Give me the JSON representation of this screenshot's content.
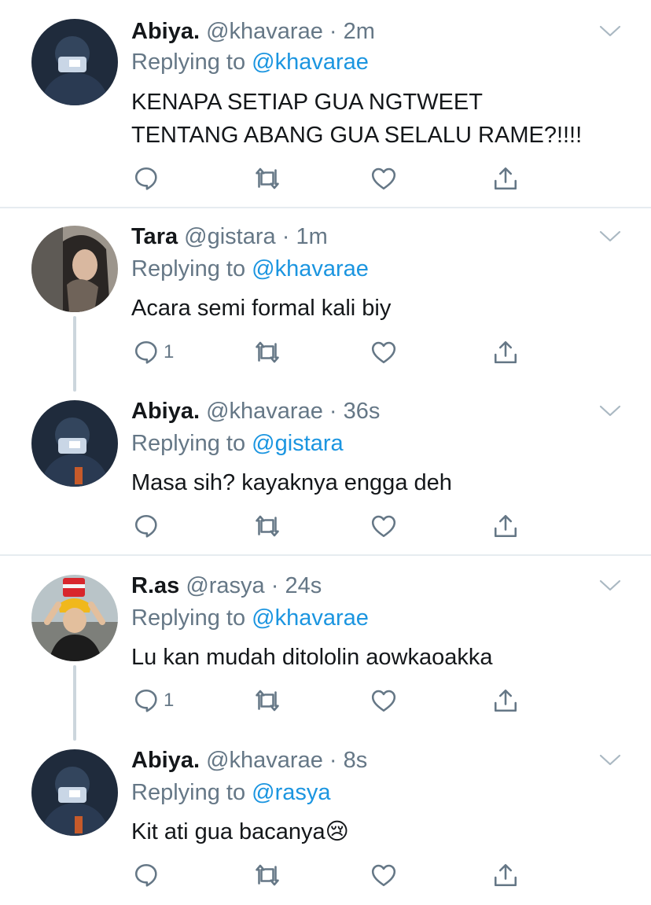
{
  "tweets": [
    {
      "name": "Abiya.",
      "handle": "@khavarae",
      "time": "2m",
      "replying_prefix": "Replying to ",
      "replying_to": "@khavarae",
      "text_lines": [
        "KENAPA SETIAP GUA NGTWEET",
        "TENTANG ABANG GUA SELALU RAME?!!!!"
      ],
      "reply_count": ""
    },
    {
      "name": "Tara",
      "handle": "@gistara",
      "time": "1m",
      "replying_prefix": "Replying to ",
      "replying_to": "@khavarae",
      "text_lines": [
        "Acara semi formal kali biy"
      ],
      "reply_count": "1"
    },
    {
      "name": "Abiya.",
      "handle": "@khavarae",
      "time": "36s",
      "replying_prefix": "Replying to ",
      "replying_to": "@gistara",
      "text_lines": [
        "Masa sih? kayaknya engga deh"
      ],
      "reply_count": ""
    },
    {
      "name": "R.as",
      "handle": "@rasya",
      "time": "24s",
      "replying_prefix": "Replying to ",
      "replying_to": "@khavarae",
      "text_lines": [
        "Lu kan mudah ditololin aowkaoakka"
      ],
      "reply_count": "1"
    },
    {
      "name": "Abiya.",
      "handle": "@khavarae",
      "time": "8s",
      "replying_prefix": "Replying to ",
      "replying_to": "@rasya",
      "text_lines": [
        "Kit ati gua bacanya"
      ],
      "emoji": "😢",
      "reply_count": ""
    }
  ],
  "separator": " · ",
  "colors": {
    "mention": "#1b95e0",
    "secondary": "#657786",
    "divider": "#e6ecf0",
    "thread_line": "#ccd6dd"
  },
  "icons": [
    "reply-icon",
    "retweet-icon",
    "like-icon",
    "share-icon",
    "chevron-down-icon"
  ]
}
